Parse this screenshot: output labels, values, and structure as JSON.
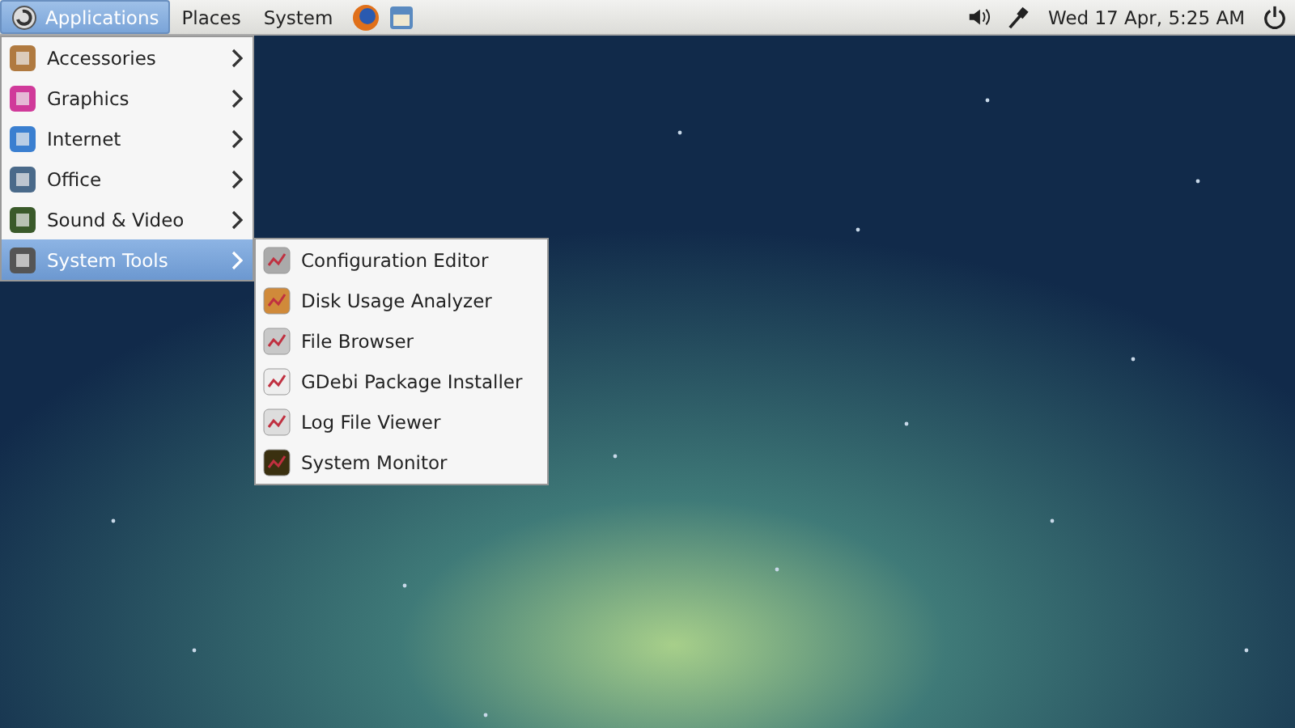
{
  "top_panel": {
    "menus": [
      {
        "label": "Applications",
        "selected": true
      },
      {
        "label": "Places",
        "selected": false
      },
      {
        "label": "System",
        "selected": false
      }
    ],
    "clock": "Wed 17 Apr, 5:25 AM"
  },
  "applications_menu": [
    {
      "label": "Accessories",
      "selected": false
    },
    {
      "label": "Graphics",
      "selected": false
    },
    {
      "label": "Internet",
      "selected": false
    },
    {
      "label": "Office",
      "selected": false
    },
    {
      "label": "Sound & Video",
      "selected": false
    },
    {
      "label": "System Tools",
      "selected": true
    }
  ],
  "system_tools_menu": [
    {
      "label": "Configuration Editor"
    },
    {
      "label": "Disk Usage Analyzer"
    },
    {
      "label": "File Browser"
    },
    {
      "label": "GDebi Package Installer"
    },
    {
      "label": "Log File Viewer"
    },
    {
      "label": "System Monitor"
    }
  ]
}
